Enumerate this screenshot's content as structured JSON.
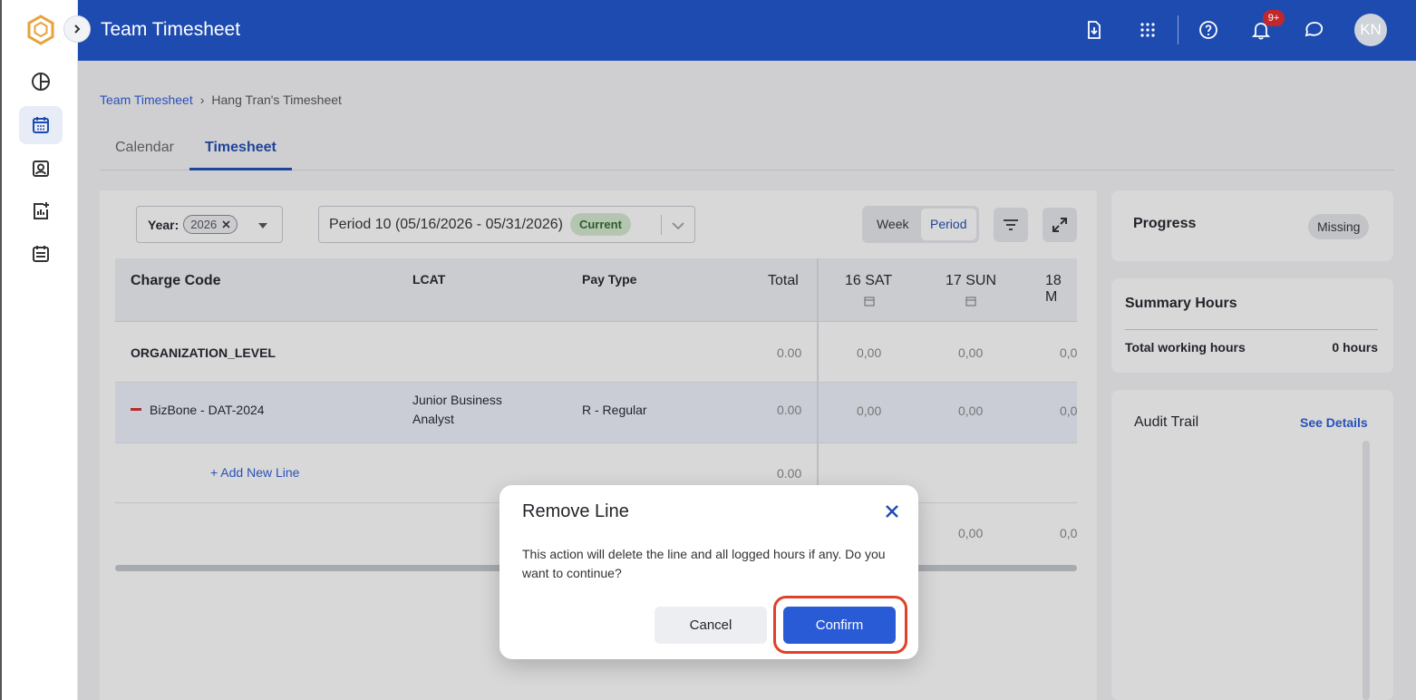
{
  "header": {
    "title": "Team Timesheet",
    "notification_count": "9+",
    "avatar_initials": "KN",
    "accent_color": "#1e4bb0"
  },
  "sidebar": {
    "items": [
      {
        "icon": "pie-chart-icon"
      },
      {
        "icon": "calendar-icon",
        "active": true
      },
      {
        "icon": "contact-card-icon"
      },
      {
        "icon": "add-report-icon"
      },
      {
        "icon": "schedule-icon"
      }
    ]
  },
  "breadcrumb": {
    "root": "Team Timesheet",
    "separator": "›",
    "current": "Hang Tran's Timesheet"
  },
  "tabs": {
    "calendar": "Calendar",
    "timesheet": "Timesheet"
  },
  "filters": {
    "year_label": "Year:",
    "year_value": "2026",
    "period_value": "Period 10 (05/16/2026 - 05/31/2026)",
    "period_badge": "Current",
    "view_week": "Week",
    "view_period": "Period"
  },
  "grid": {
    "columns": {
      "charge_code": "Charge Code",
      "lcat": "LCAT",
      "pay_type": "Pay Type",
      "total": "Total",
      "day1": "16 SAT",
      "day2": "17 SUN",
      "day3": "18 M"
    },
    "org_row": {
      "name": "ORGANIZATION_LEVEL",
      "total": "0.00",
      "day1": "0,00",
      "day2": "0,00",
      "day3": "0,0"
    },
    "line_row": {
      "charge_code": "BizBone - DAT-2024",
      "lcat_line1": "Junior Business",
      "lcat_line2": "Analyst",
      "pay_type": "R - Regular",
      "total": "0.00",
      "day1": "0,00",
      "day2": "0,00",
      "day3": "0,0"
    },
    "add_row": {
      "label": "+ Add New Line",
      "total": "0.00"
    },
    "footer_row": {
      "day2": "0,00",
      "day3": "0,0"
    }
  },
  "progress": {
    "title": "Progress",
    "status": "Missing"
  },
  "summary": {
    "title": "Summary Hours",
    "total_label": "Total working hours",
    "total_value": "0 hours"
  },
  "audit": {
    "title": "Audit Trail",
    "link": "See Details"
  },
  "modal": {
    "title": "Remove Line",
    "message": "This action will delete the line and all logged hours if any. Do you want to continue?",
    "cancel": "Cancel",
    "confirm": "Confirm"
  }
}
